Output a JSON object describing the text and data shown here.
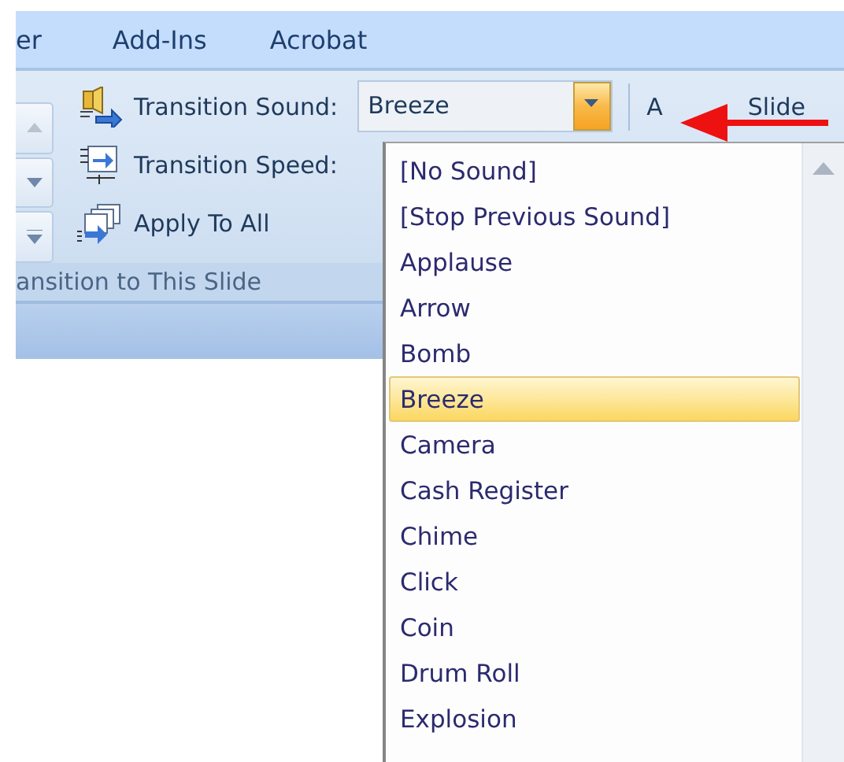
{
  "tabs": [
    {
      "label": "er"
    },
    {
      "label": "Add-Ins"
    },
    {
      "label": "Acrobat"
    }
  ],
  "ribbon": {
    "transition_sound": {
      "label": "Transition Sound:",
      "value": "Breeze",
      "open": true
    },
    "transition_speed": {
      "label": "Transition Speed:"
    },
    "apply_to_all": {
      "label": "Apply To All"
    },
    "advance_slide": {
      "label_start": "A",
      "label_end": "Slide"
    },
    "group_label": "ansition to This Slide"
  },
  "sound_list": {
    "items": [
      {
        "label": "[No Sound]",
        "selected": false
      },
      {
        "label": "[Stop Previous Sound]",
        "selected": false
      },
      {
        "label": "Applause",
        "selected": false
      },
      {
        "label": "Arrow",
        "selected": false
      },
      {
        "label": "Bomb",
        "selected": false
      },
      {
        "label": "Breeze",
        "selected": true
      },
      {
        "label": "Camera",
        "selected": false
      },
      {
        "label": "Cash Register",
        "selected": false
      },
      {
        "label": "Chime",
        "selected": false
      },
      {
        "label": "Click",
        "selected": false
      },
      {
        "label": "Coin",
        "selected": false
      },
      {
        "label": "Drum Roll",
        "selected": false
      },
      {
        "label": "Explosion",
        "selected": false
      }
    ]
  }
}
